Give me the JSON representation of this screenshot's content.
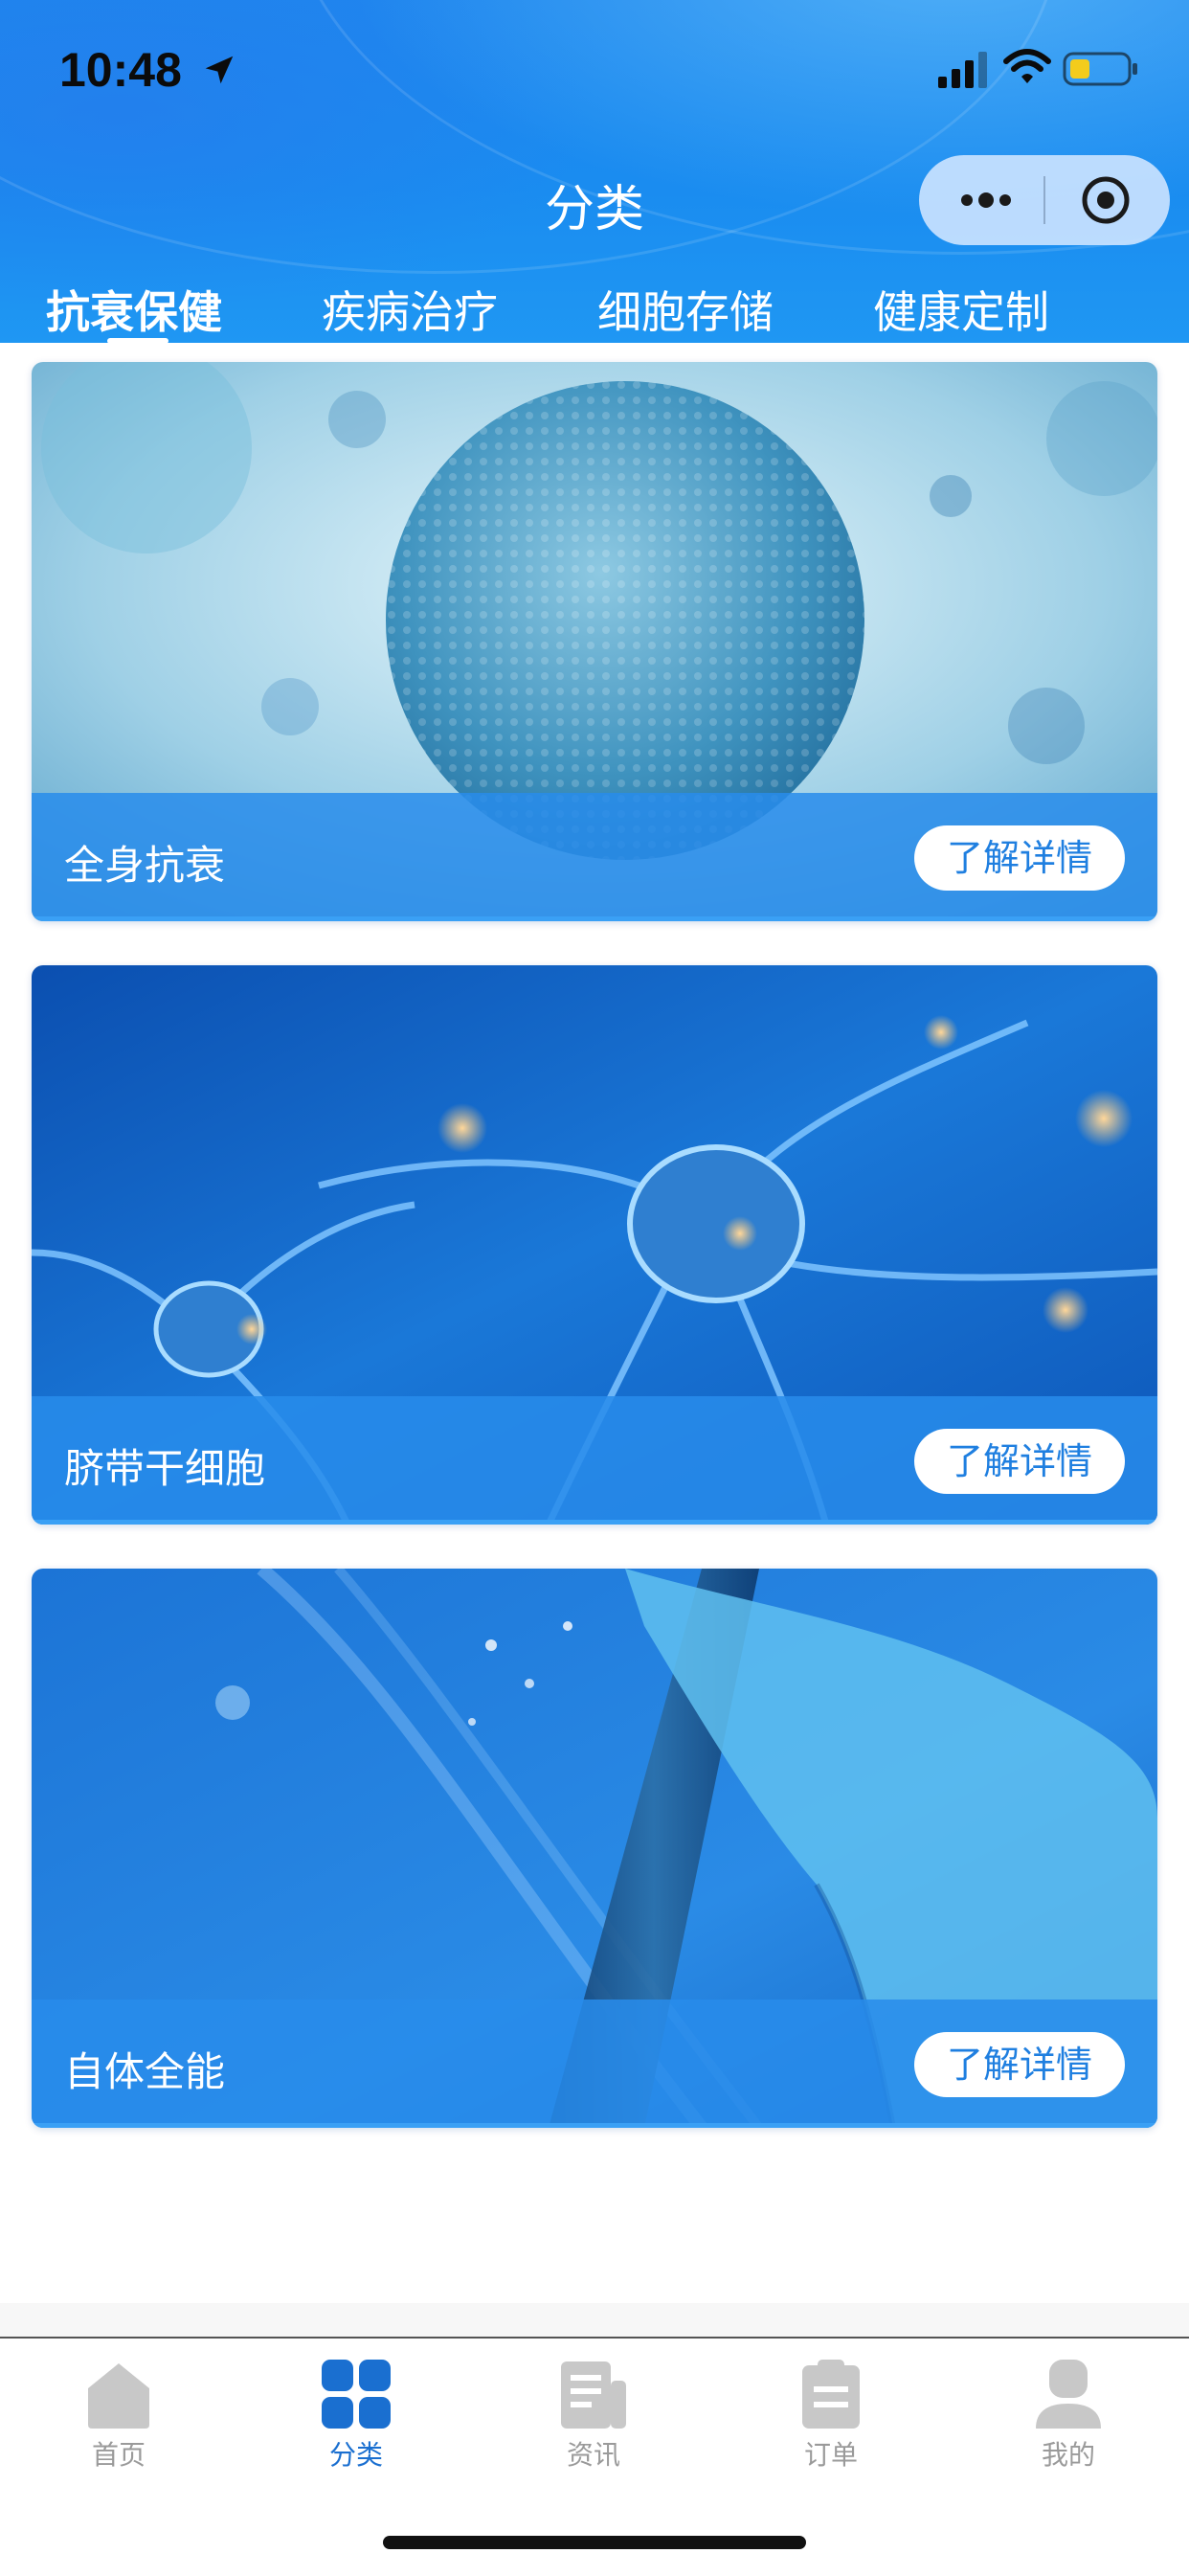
{
  "status_bar": {
    "time": "10:48",
    "icons": [
      "location-arrow-icon",
      "signal-icon",
      "wifi-icon",
      "battery-icon"
    ]
  },
  "header": {
    "title": "分类",
    "capsule_icons": [
      "more-dots-icon",
      "target-icon"
    ]
  },
  "tabs": [
    {
      "label": "抗衰保健",
      "active": true
    },
    {
      "label": "疾病治疗",
      "active": false
    },
    {
      "label": "细胞存储",
      "active": false
    },
    {
      "label": "健康定制",
      "active": false
    }
  ],
  "cards": [
    {
      "title": "全身抗衰",
      "button": "了解详情",
      "image": "cell-sphere-image"
    },
    {
      "title": "脐带干细胞",
      "button": "了解详情",
      "image": "neuron-cells-image"
    },
    {
      "title": "自体全能",
      "button": "了解详情",
      "image": "lab-test-tube-image"
    }
  ],
  "bottom_nav": [
    {
      "label": "首页",
      "icon": "home-icon",
      "active": false
    },
    {
      "label": "分类",
      "icon": "grid-icon",
      "active": true
    },
    {
      "label": "资讯",
      "icon": "news-icon",
      "active": false
    },
    {
      "label": "订单",
      "icon": "clipboard-icon",
      "active": false
    },
    {
      "label": "我的",
      "icon": "user-icon",
      "active": false
    }
  ],
  "colors": {
    "header_blue": "#1e86ee",
    "active_nav": "#1a6fd0",
    "inactive_nav": "#9a9a9a",
    "card_bar": "#288ceb"
  }
}
